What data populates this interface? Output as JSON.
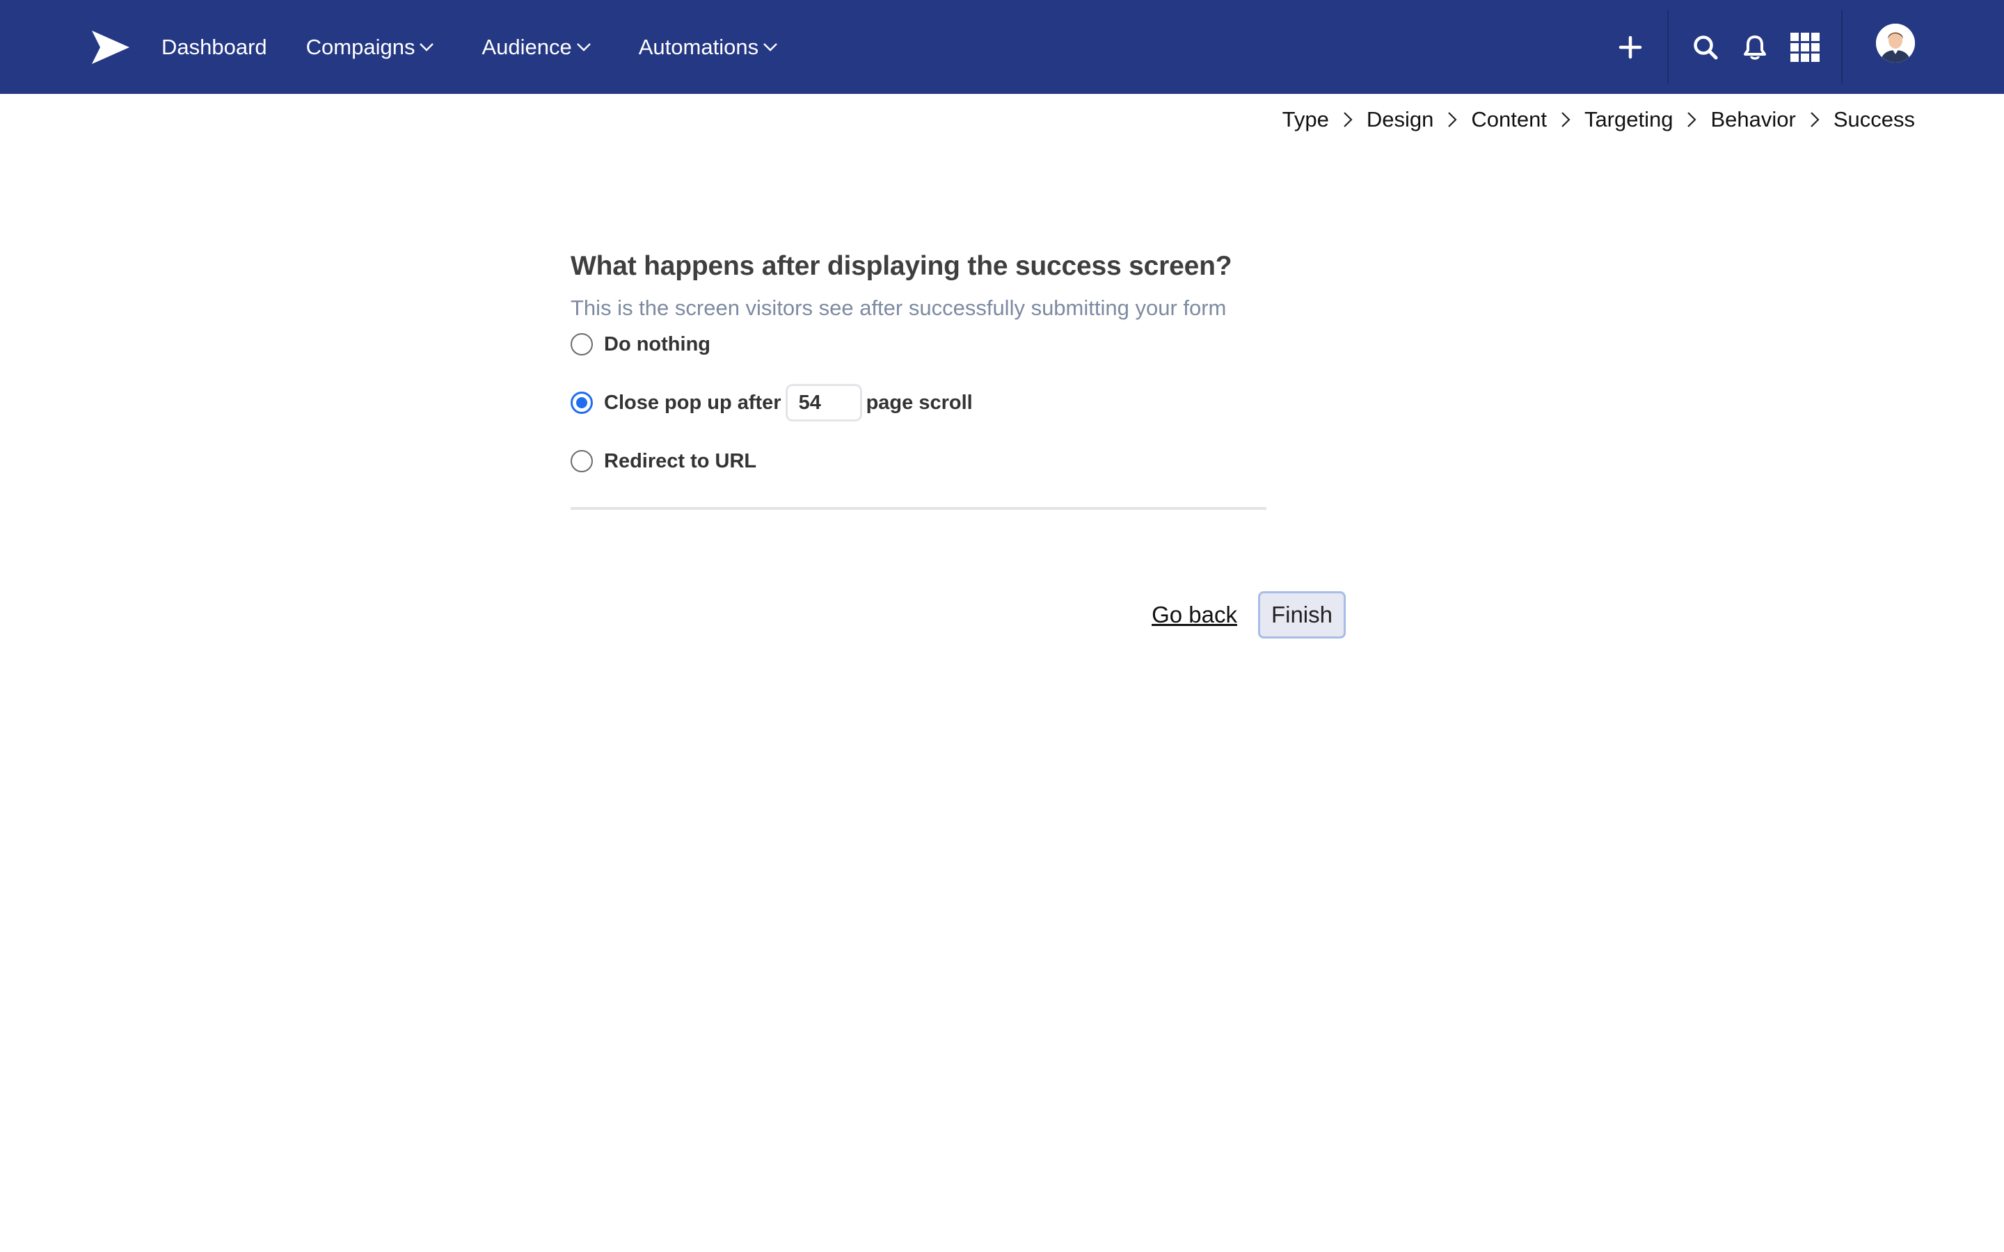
{
  "nav": {
    "logo_icon": "paper-plane-icon",
    "items": [
      {
        "label": "Dashboard",
        "has_dropdown": false
      },
      {
        "label": "Compaigns",
        "has_dropdown": true
      },
      {
        "label": "Audience",
        "has_dropdown": true
      },
      {
        "label": "Automations",
        "has_dropdown": true
      }
    ],
    "actions": [
      "plus-icon",
      "search-icon",
      "bell-icon",
      "grid-icon",
      "avatar"
    ]
  },
  "breadcrumb": [
    "Type",
    "Design",
    "Content",
    "Targeting",
    "Behavior",
    "Success"
  ],
  "main": {
    "title": "What happens after displaying the success screen?",
    "subtitle": "This is the screen visitors see after successfully submitting your form",
    "options": {
      "do_nothing": "Do nothing",
      "close_prefix": "Close pop up after",
      "close_value": "54",
      "close_suffix": "page scroll",
      "redirect": "Redirect to URL"
    },
    "selected_option": "close"
  },
  "footer": {
    "back_label": "Go back",
    "finish_label": "Finish"
  },
  "colors": {
    "nav_bg": "#253884",
    "accent": "#1f6ef0",
    "subtitle": "#7d8aa0"
  }
}
